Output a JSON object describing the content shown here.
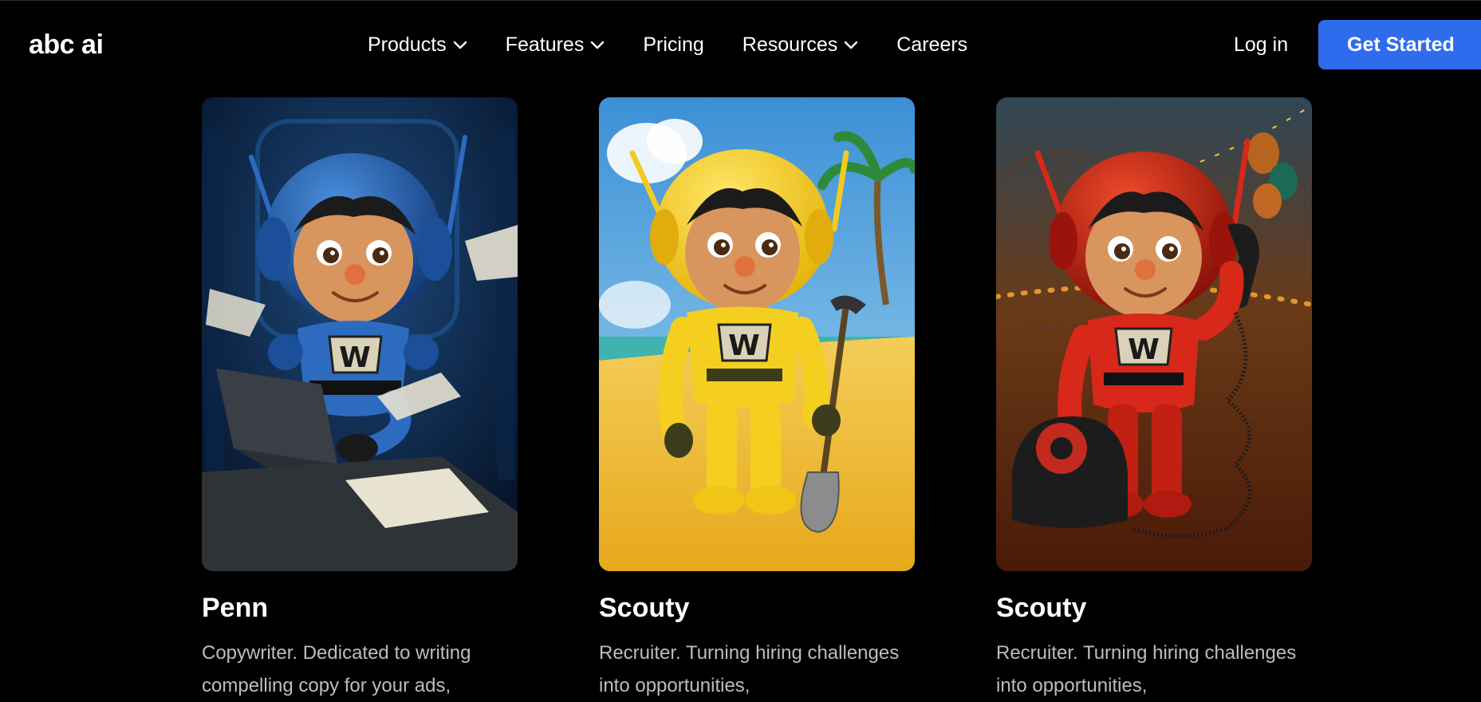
{
  "brand": {
    "logo_text": "abc ai"
  },
  "nav": {
    "items": [
      {
        "label": "Products",
        "has_dropdown": true,
        "icon": "chevron-down-icon"
      },
      {
        "label": "Features",
        "has_dropdown": true,
        "icon": "chevron-down-icon"
      },
      {
        "label": "Pricing",
        "has_dropdown": false
      },
      {
        "label": "Resources",
        "has_dropdown": true,
        "icon": "chevron-down-icon"
      },
      {
        "label": "Careers",
        "has_dropdown": false
      }
    ],
    "login_label": "Log in",
    "cta_label": "Get Started"
  },
  "colors": {
    "background": "#000000",
    "cta": "#2f6bed",
    "text": "#ffffff",
    "muted_text": "#b9bdc6"
  },
  "cards": [
    {
      "name": "Penn",
      "description": "Copywriter. Dedicated to writing compelling copy for your ads,",
      "image": "blue-robot-at-laptop-illustration"
    },
    {
      "name": "Scouty",
      "description": "Recruiter. Turning hiring challenges into opportunities,",
      "image": "yellow-robot-with-shovel-on-beach-illustration"
    },
    {
      "name": "Scouty",
      "description": "Recruiter. Turning hiring challenges into opportunities,",
      "image": "red-robot-with-telephone-at-fair-illustration"
    }
  ]
}
